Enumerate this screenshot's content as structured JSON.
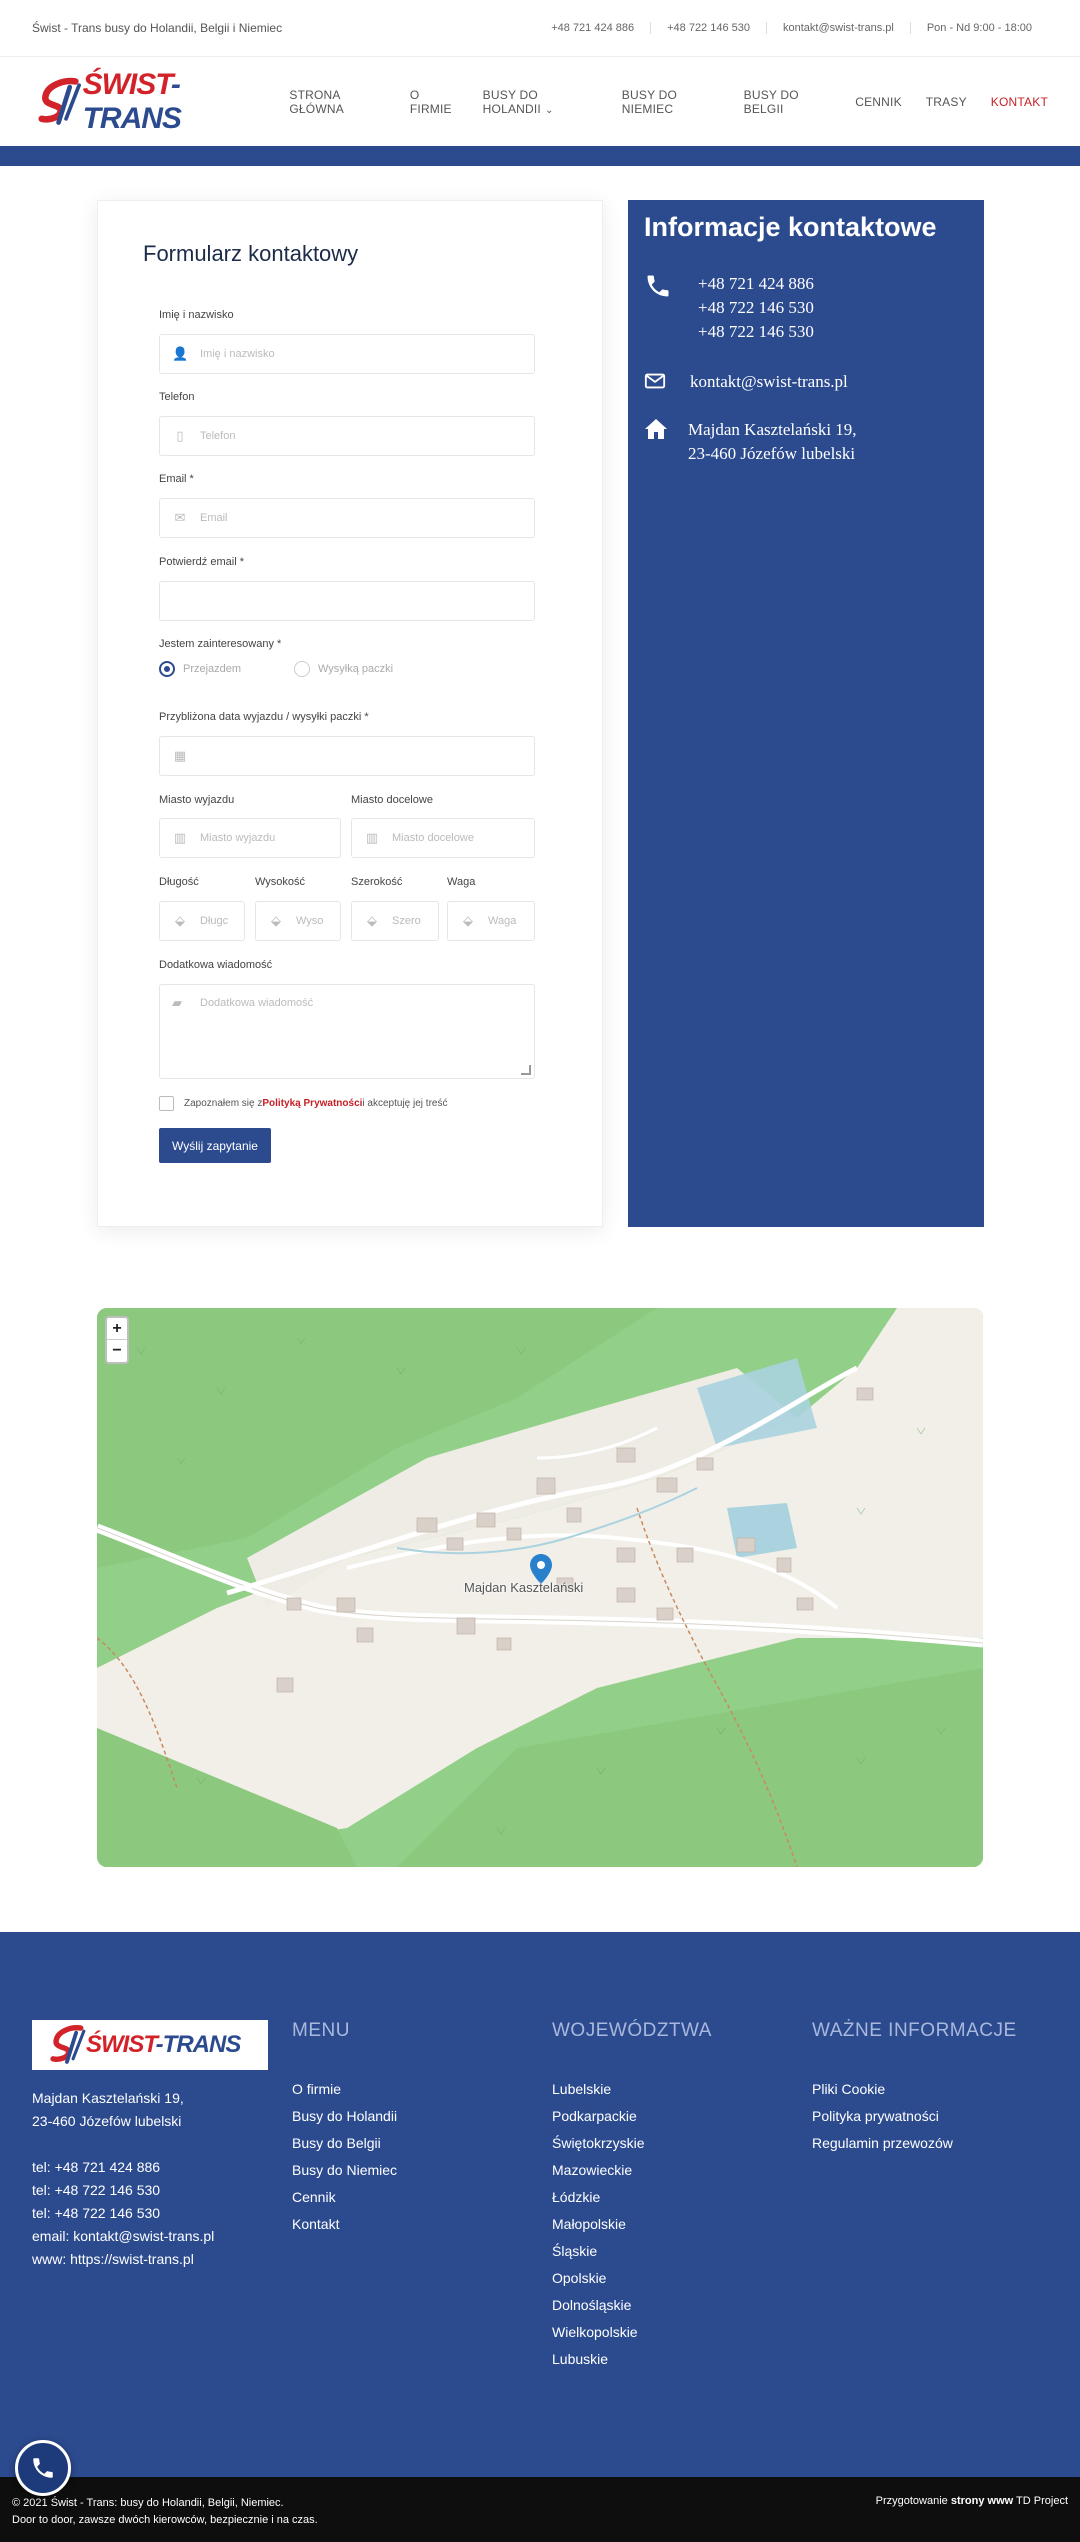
{
  "topbar": {
    "tagline": "Świst - Trans busy do Holandii, Belgii i Niemiec",
    "phone": "+48 721 424 886",
    "phone2": "+48 722 146 530",
    "email": "kontakt@swist-trans.pl",
    "hours": "Pon - Nd 9:00 - 18:00"
  },
  "logo": {
    "part1": "ŚWIST",
    "dash": "-",
    "part2": "TRANS"
  },
  "nav": {
    "items": [
      "STRONA GŁÓWNA",
      "O FIRMIE",
      "BUSY DO HOLANDII",
      "BUSY DO NIEMIEC",
      "BUSY DO BELGII",
      "CENNIK",
      "TRASY",
      "KONTAKT"
    ]
  },
  "form": {
    "title": "Formularz kontaktowy",
    "name_label": "Imię i nazwisko",
    "name_ph": "Imię i nazwisko",
    "phone_label": "Telefon",
    "phone_ph": "Telefon",
    "email_label": "Email *",
    "email_ph": "Email",
    "confirm_label": "Potwierdź email *",
    "interest_label": "Jestem zainteresowany *",
    "opt1": "Przejazdem",
    "opt2": "Wysyłką paczki",
    "date_label": "Przybliżona data wyjazdu / wysyłki paczki *",
    "from_label": "Miasto wyjazdu",
    "from_ph": "Miasto wyjazdu",
    "to_label": "Miasto docelowe",
    "to_ph": "Miasto docelowe",
    "len_label": "Długość",
    "len_ph": "Długc",
    "h_label": "Wysokość",
    "h_ph": "Wyso",
    "w_label": "Szerokość",
    "w_ph": "Szero",
    "wt_label": "Waga",
    "wt_ph": "Waga",
    "msg_label": "Dodatkowa wiadomość",
    "msg_ph": "Dodatkowa wiadomość",
    "consent_pre": "Zapoznałem się z ",
    "consent_link": "Polityką Prywatności",
    "consent_post": " i akceptuję jej treść",
    "submit": "Wyślij zapytanie"
  },
  "info": {
    "title": "Informacje kontaktowe",
    "phones": [
      "+48 721 424 886",
      "+48 722 146 530",
      "+48 722 146 530"
    ],
    "email": "kontakt@swist-trans.pl",
    "address1": "Majdan Kasztelański 19,",
    "address2": "23-460 Józefów lubelski"
  },
  "map": {
    "place": "Majdan Kasztelański",
    "zoom_in": "+",
    "zoom_out": "−"
  },
  "footer": {
    "address1": "Majdan Kasztelański 19,",
    "address2": "23-460 Józefów lubelski",
    "tel1": "tel: +48 721 424 886",
    "tel2": "tel: +48 722 146 530",
    "tel3": "tel: +48 722 146 530",
    "email": "email: kontakt@swist-trans.pl",
    "www": "www: https://swist-trans.pl",
    "menu_title": "MENU",
    "menu": [
      "O firmie",
      "Busy do Holandii",
      "Busy do Belgii",
      "Busy do Niemiec",
      "Cennik",
      "Kontakt"
    ],
    "woj_title": "WOJEWÓDZTWA",
    "woj": [
      "Lubelskie",
      "Podkarpackie",
      "Świętokrzyskie",
      "Mazowieckie",
      "Łódzkie",
      "Małopolskie",
      "Śląskie",
      "Opolskie",
      "Dolnośląskie",
      "Wielkopolskie",
      "Lubuskie"
    ],
    "info_title": "WAŻNE INFORMACJE",
    "info": [
      "Pliki Cookie",
      "Polityka prywatności",
      "Regulamin przewozów"
    ]
  },
  "bottom": {
    "line1": "© 2021 Świst - Trans: busy do Holandii, Belgii, Niemiec.",
    "line2": "Door to door, zawsze dwóch kierowców, bezpiecznie i na czas.",
    "credit_pre": "Przygotowanie ",
    "credit_bold": "strony www",
    "credit_post": " TD Project"
  },
  "colors": {
    "brand_blue": "#2c4b8f",
    "brand_red": "#d2232a"
  }
}
